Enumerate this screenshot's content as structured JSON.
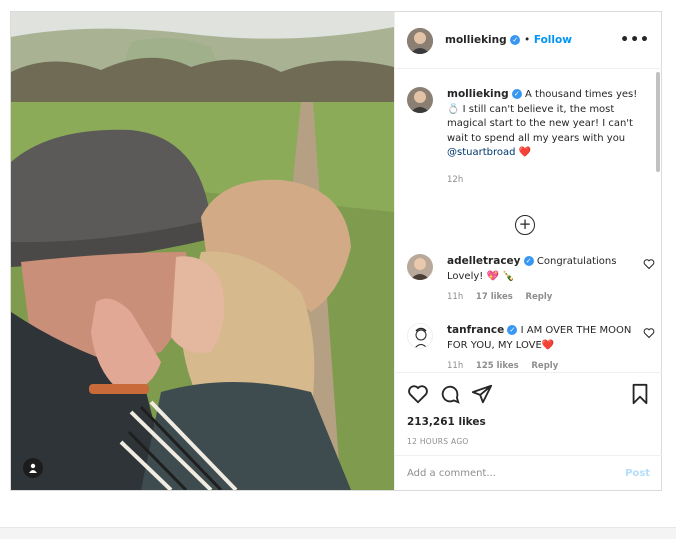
{
  "post": {
    "username": "mollieking",
    "follow_label": "Follow",
    "separator": "•",
    "more_label": "•••",
    "photo_alt": "Photo of couple kissing in a field"
  },
  "caption": {
    "username": "mollieking",
    "text_1": "A thousand times yes!",
    "text_2": "💍 I still can't believe it, the most magical start to the new year! I can't wait to spend all my years with you",
    "mention": "@stuartbroad",
    "heart": "❤️",
    "time": "12h"
  },
  "load_more_label": "+",
  "comments": [
    {
      "username": "adelletracey",
      "text": "Congratulations Lovely!",
      "emoji": "💖 🍾",
      "time": "11h",
      "likes": "17 likes",
      "reply": "Reply"
    },
    {
      "username": "tanfrance",
      "text": "I AM OVER THE MOON FOR YOU, MY LOVE",
      "emoji": "❤️",
      "time": "11h",
      "likes": "125 likes",
      "reply": "Reply"
    }
  ],
  "actions": {
    "likes_count": "213,261 likes",
    "time_ago": "12 HOURS AGO"
  },
  "comment_box": {
    "placeholder": "Add a comment...",
    "post_label": "Post"
  },
  "icons": [
    "heart-icon",
    "comment-icon",
    "share-icon",
    "bookmark-icon",
    "verified-icon",
    "more-icon",
    "user-tag-icon",
    "add-circle-icon"
  ],
  "colors": {
    "accent": "#0095f6",
    "verified": "#3897f0",
    "border": "#dbdbdb",
    "muted": "#8e8e8e"
  }
}
